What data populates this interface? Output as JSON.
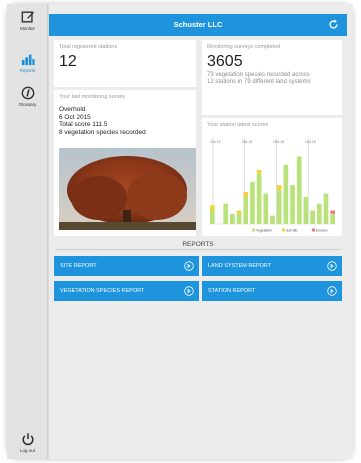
{
  "header": {
    "title": "Schuster LLC"
  },
  "sidebar": {
    "items": [
      {
        "label": "Monitor",
        "icon": "edit-icon"
      },
      {
        "label": "Reports",
        "icon": "bar-chart-icon"
      },
      {
        "label": "Glossary",
        "icon": "info-icon"
      }
    ],
    "logout_label": "Log out"
  },
  "stats": {
    "stations_caption": "Total registered stations",
    "stations_value": "12",
    "surveys_caption": "Monitoring surveys completed",
    "surveys_value": "3605",
    "surveys_desc": "73 vegetation species recorded across 12 stations in 79 different land systems"
  },
  "last_survey": {
    "caption": "Your last monitoring survey",
    "line1": "Overhold",
    "line2": "6 Oct 2015",
    "line3": "Total score 111.5",
    "line4": "8 vegetation species recorded"
  },
  "chart_data": {
    "type": "bar",
    "title": "Your station latest scores",
    "categories": [
      "Oct 15",
      "Oct 15",
      "Oct 15",
      "Oct 15"
    ],
    "series": [
      {
        "name": "Vegetation",
        "color": "#b9e37a"
      },
      {
        "name": "Soil attr.",
        "color": "#f3d23a"
      },
      {
        "name": "Erosion",
        "color": "#f07a7a"
      }
    ],
    "bars": [
      {
        "veg": 8,
        "soil": 3,
        "ero": 0
      },
      {
        "veg": 0,
        "soil": 0,
        "ero": 0
      },
      {
        "veg": 12,
        "soil": 0,
        "ero": 0
      },
      {
        "veg": 6,
        "soil": 0,
        "ero": 0
      },
      {
        "veg": 6,
        "soil": 2,
        "ero": 0
      },
      {
        "veg": 16,
        "soil": 3,
        "ero": 0
      },
      {
        "veg": 25,
        "soil": 0,
        "ero": 0
      },
      {
        "veg": 30,
        "soil": 2,
        "ero": 0
      },
      {
        "veg": 18,
        "soil": 0,
        "ero": 0
      },
      {
        "veg": 5,
        "soil": 0,
        "ero": 0
      },
      {
        "veg": 20,
        "soil": 3,
        "ero": 0
      },
      {
        "veg": 35,
        "soil": 0,
        "ero": 0
      },
      {
        "veg": 23,
        "soil": 0,
        "ero": 0
      },
      {
        "veg": 40,
        "soil": 0,
        "ero": 0
      },
      {
        "veg": 16,
        "soil": 0,
        "ero": 0
      },
      {
        "veg": 8,
        "soil": 0,
        "ero": 0
      },
      {
        "veg": 12,
        "soil": 0,
        "ero": 0
      },
      {
        "veg": 18,
        "soil": 0,
        "ero": 0
      },
      {
        "veg": 6,
        "soil": 0,
        "ero": 2
      }
    ],
    "ylim": [
      0,
      45
    ]
  },
  "reports": {
    "title": "REPORTS",
    "site": "SITE REPORT",
    "land": "LAND SYSTEM REPORT",
    "veg": "VEGETATION SPECIES REPORT",
    "station": "STATION REPORT"
  },
  "colors": {
    "accent": "#1d94dc"
  }
}
